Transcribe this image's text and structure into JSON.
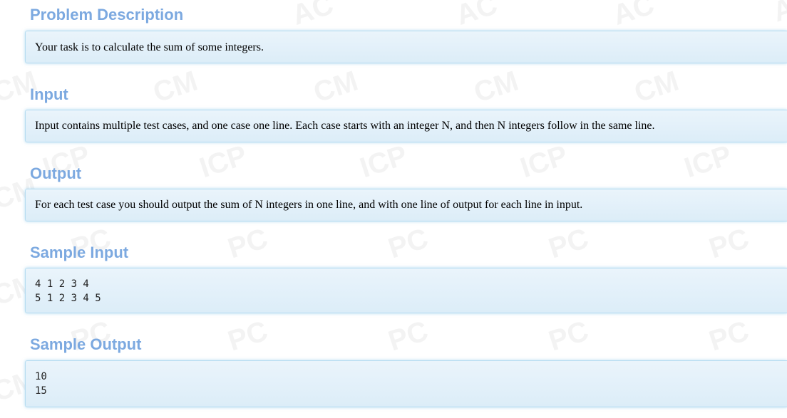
{
  "sections": {
    "description": {
      "title": "Problem Description",
      "text": "Your task is to calculate the sum of some integers."
    },
    "input": {
      "title": "Input",
      "text": "Input contains multiple test cases, and one case one line. Each case starts with an integer N, and then N integers follow in the same line."
    },
    "output": {
      "title": "Output",
      "text": "For each test case you should output the sum of N integers in one line, and with one line of output for each line in input."
    },
    "sample_input": {
      "title": "Sample Input",
      "text": "4 1 2 3 4\n5 1 2 3 4 5"
    },
    "sample_output": {
      "title": "Sample Output",
      "text": "10\n15"
    }
  },
  "colors": {
    "heading": "#7ca9e0",
    "panel_bg": "#e4f1fa",
    "panel_border": "#b5dcf1"
  }
}
